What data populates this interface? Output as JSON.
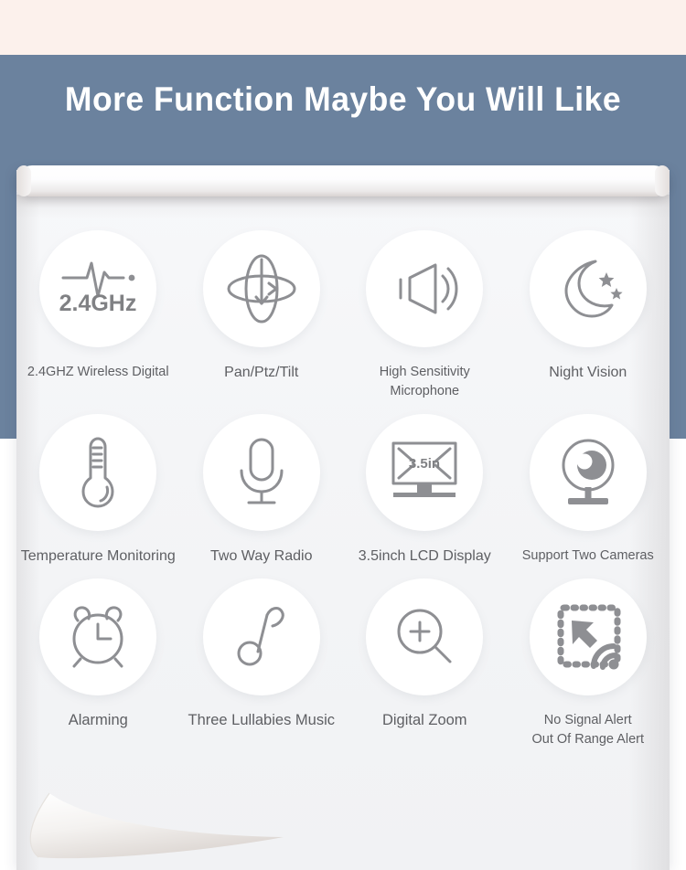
{
  "banner": {
    "title": "More Function Maybe You Will Like",
    "background_color": "#6b829e",
    "title_color": "#ffffff",
    "top_strip_color": "#fcf1ec"
  },
  "paper": {
    "background_color": "#f4f5f7",
    "caption_color": "#5e5f63",
    "bubble_color": "#ffffff",
    "icon_color": "#8e8f93"
  },
  "features": [
    {
      "icon": "wireless-signal-icon",
      "icon_label": "2.4GHz",
      "label": "2.4GHZ Wireless Digital"
    },
    {
      "icon": "pan-tilt-rotation-icon",
      "label": "Pan/Ptz/Tilt"
    },
    {
      "icon": "speaker-microphone-icon",
      "label": "High Sensitivity Microphone"
    },
    {
      "icon": "moon-stars-icon",
      "label": "Night Vision"
    },
    {
      "icon": "thermometer-icon",
      "label": "Temperature Monitoring"
    },
    {
      "icon": "microphone-icon",
      "label": "Two Way Radio"
    },
    {
      "icon": "lcd-monitor-icon",
      "icon_label": "3.5in",
      "label": "3.5inch LCD Display"
    },
    {
      "icon": "webcam-icon",
      "label": "Support Two Cameras"
    },
    {
      "icon": "alarm-clock-icon",
      "label": "Alarming"
    },
    {
      "icon": "music-note-icon",
      "label": "Three Lullabies Music"
    },
    {
      "icon": "magnifier-plus-icon",
      "label": "Digital Zoom"
    },
    {
      "icon": "no-signal-alert-icon",
      "label": "No Signal Alert\nOut Of Range Alert"
    }
  ]
}
